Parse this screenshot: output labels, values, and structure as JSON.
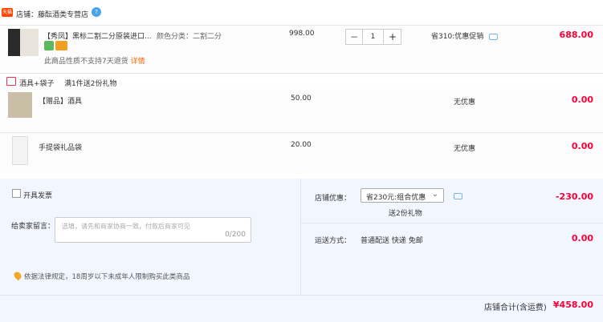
{
  "shop": {
    "badge": "天猫",
    "name": "店铺：藤酝酒类专营店",
    "level_badge": "?"
  },
  "items": [
    {
      "title": "【秀凤】黑标二割二分原装进口...",
      "sku": "颜色分类：二割二分",
      "price": "998.00",
      "qty": "1",
      "minus": "−",
      "plus": "+",
      "promo": "省310:优惠促销",
      "subtotal": "688.00",
      "notice": "此商品性质不支持7天退货",
      "notice_link": "详情"
    },
    {
      "title": "【赠品】酒具",
      "price": "50.00",
      "promo": "无优惠",
      "subtotal": "0.00"
    },
    {
      "title": "手提袋礼品袋",
      "price": "20.00",
      "promo": "无优惠",
      "subtotal": "0.00"
    }
  ],
  "gift": {
    "title": "酒具+袋子",
    "rule": "满1件送2份礼物"
  },
  "invoice": {
    "label": "开具发票"
  },
  "message": {
    "label": "给卖家留言：",
    "placeholder": "选填，请先和商家协商一致，付款后商家可见",
    "counter": "0/200"
  },
  "legal": {
    "text": "依据法律规定，18周岁以下未成年人限制购买此类商品"
  },
  "discount": {
    "label": "店铺优惠：",
    "selected": "省230元:组合优惠",
    "gift_note": "送2份礼物",
    "amount": "-230.00"
  },
  "shipping": {
    "label": "运送方式：",
    "method": "普通配送 快递 免邮",
    "amount": "0.00"
  },
  "total": {
    "label": "店铺合计(含运费)",
    "amount": "¥458.00"
  }
}
